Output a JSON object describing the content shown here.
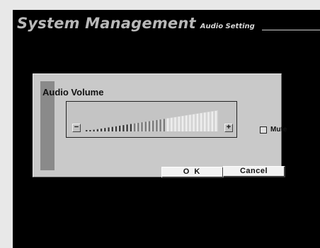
{
  "header": {
    "title": "System Management",
    "subtitle": "Audio Setting"
  },
  "dialog": {
    "title": "Audio Volume",
    "volume": {
      "minus_label": "−",
      "plus_label": "+",
      "level": 0.55
    },
    "mute": {
      "label": "Mute",
      "checked": false
    },
    "ok_label": "O K",
    "cancel_label": "Cancel"
  },
  "colors": {
    "screen_bg": "#000000",
    "dialog_bg": "#c9c9c9",
    "title_color": "#b8b8b8"
  }
}
